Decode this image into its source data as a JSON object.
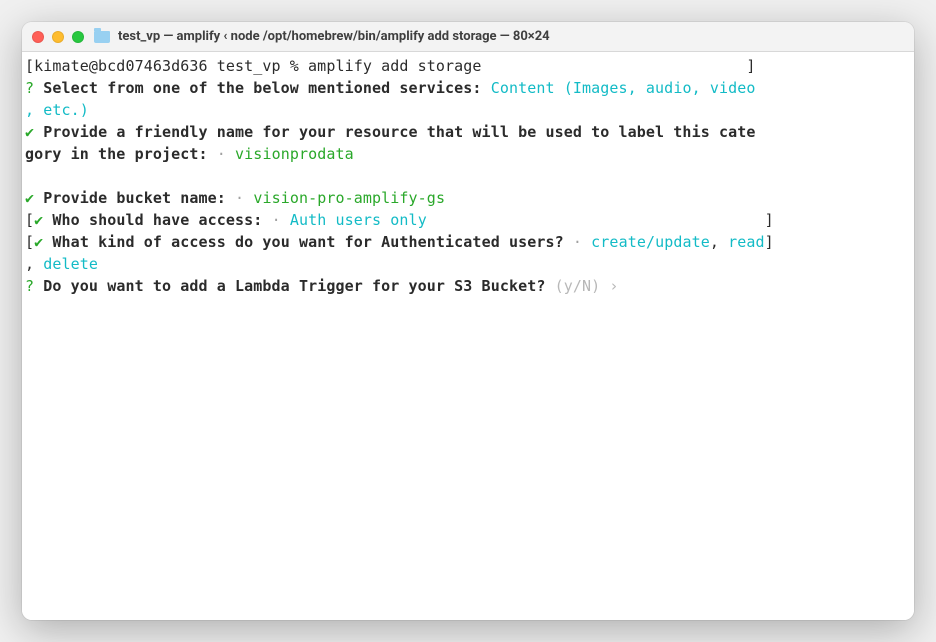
{
  "titlebar": {
    "title": "test_vp — amplify ‹ node /opt/homebrew/bin/amplify add storage — 80×24"
  },
  "prompt": {
    "line": "[kimate@bcd07463d636 test_vp % amplify add storage                             ]"
  },
  "q1": {
    "marker": "?",
    "text": "Select from one of the below mentioned services:",
    "answer1": "Content (Images, audio, video",
    "answerPrefix": ", ",
    "answer2": "etc.)"
  },
  "q2": {
    "marker": "✔",
    "text1": "Provide a friendly name for your resource that will be used to label this cate",
    "text2": "gory in the project:",
    "dot": "·",
    "answer": "visionprodata"
  },
  "q3": {
    "marker": "✔",
    "text": "Provide bucket name:",
    "dot": "·",
    "answer": "vision-pro-amplify-gs"
  },
  "q4": {
    "open": "[",
    "marker": "✔",
    "text": "Who should have access:",
    "dot": "·",
    "answer": "Auth users only",
    "close": "]",
    "pad": "                                     "
  },
  "q5": {
    "open": "[",
    "marker": "✔",
    "text": "What kind of access do you want for Authenticated users?",
    "dot": "·",
    "a1": "create/update",
    "c1": ", ",
    "a2": "read",
    "close": "]",
    "c2": ", ",
    "a3": "delete"
  },
  "q6": {
    "marker": "?",
    "text": "Do you want to add a Lambda Trigger for your S3 Bucket?",
    "hint": "(y/N) ›"
  }
}
